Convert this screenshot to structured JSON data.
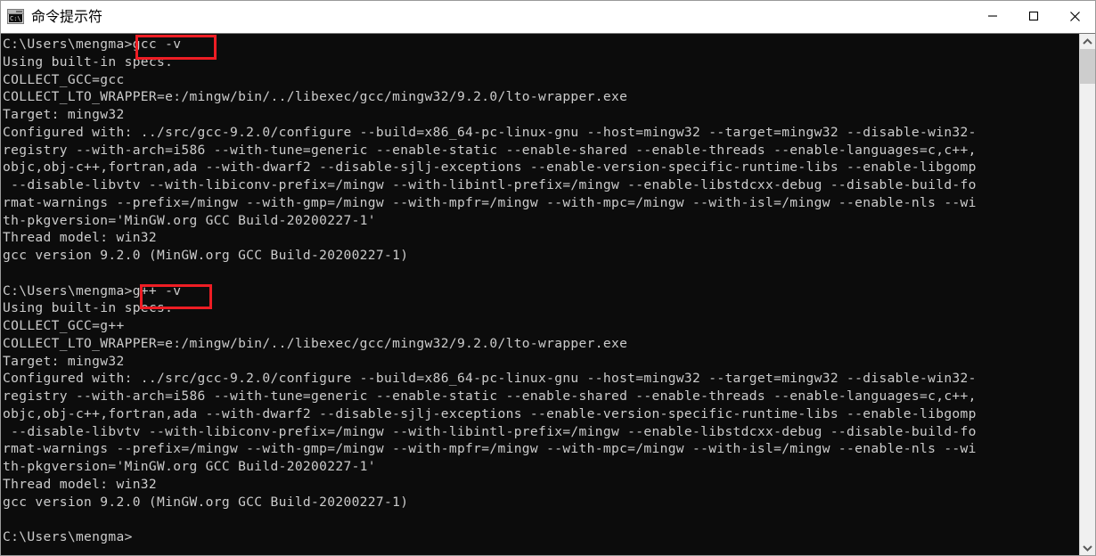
{
  "window": {
    "title": "命令提示符",
    "icon": "cmd-icon",
    "icon_text": "C:\\_",
    "controls": {
      "minimize": "minimize-icon",
      "maximize": "maximize-icon",
      "close": "close-icon"
    }
  },
  "colors": {
    "terminal_background": "#0c0c0c",
    "terminal_foreground": "#cccccc",
    "annotation": "#ee1d24",
    "titlebar_background": "#ffffff",
    "scrollbar_track": "#f0f0f0",
    "scrollbar_thumb": "#cdcdcd"
  },
  "terminal": {
    "prompt": "C:\\Users\\mengma>",
    "commands": [
      "gcc -v",
      "g++ -v"
    ],
    "annotated_commands": [
      ">gcc -v",
      "g++ -v"
    ],
    "content": "C:\\Users\\mengma>gcc -v\nUsing built-in specs.\nCOLLECT_GCC=gcc\nCOLLECT_LTO_WRAPPER=e:/mingw/bin/../libexec/gcc/mingw32/9.2.0/lto-wrapper.exe\nTarget: mingw32\nConfigured with: ../src/gcc-9.2.0/configure --build=x86_64-pc-linux-gnu --host=mingw32 --target=mingw32 --disable-win32-\nregistry --with-arch=i586 --with-tune=generic --enable-static --enable-shared --enable-threads --enable-languages=c,c++,\nobjc,obj-c++,fortran,ada --with-dwarf2 --disable-sjlj-exceptions --enable-version-specific-runtime-libs --enable-libgomp\n --disable-libvtv --with-libiconv-prefix=/mingw --with-libintl-prefix=/mingw --enable-libstdcxx-debug --disable-build-fo\nrmat-warnings --prefix=/mingw --with-gmp=/mingw --with-mpfr=/mingw --with-mpc=/mingw --with-isl=/mingw --enable-nls --wi\nth-pkgversion='MinGW.org GCC Build-20200227-1'\nThread model: win32\ngcc version 9.2.0 (MinGW.org GCC Build-20200227-1)\n\nC:\\Users\\mengma>g++ -v\nUsing built-in specs.\nCOLLECT_GCC=g++\nCOLLECT_LTO_WRAPPER=e:/mingw/bin/../libexec/gcc/mingw32/9.2.0/lto-wrapper.exe\nTarget: mingw32\nConfigured with: ../src/gcc-9.2.0/configure --build=x86_64-pc-linux-gnu --host=mingw32 --target=mingw32 --disable-win32-\nregistry --with-arch=i586 --with-tune=generic --enable-static --enable-shared --enable-threads --enable-languages=c,c++,\nobjc,obj-c++,fortran,ada --with-dwarf2 --disable-sjlj-exceptions --enable-version-specific-runtime-libs --enable-libgomp\n --disable-libvtv --with-libiconv-prefix=/mingw --with-libintl-prefix=/mingw --enable-libstdcxx-debug --disable-build-fo\nrmat-warnings --prefix=/mingw --with-gmp=/mingw --with-mpfr=/mingw --with-mpc=/mingw --with-isl=/mingw --enable-nls --wi\nth-pkgversion='MinGW.org GCC Build-20200227-1'\nThread model: win32\ngcc version 9.2.0 (MinGW.org GCC Build-20200227-1)\n\nC:\\Users\\mengma>"
  },
  "scrollbar": {
    "up_arrow": "chevron-up-icon",
    "down_arrow": "chevron-down-icon"
  }
}
